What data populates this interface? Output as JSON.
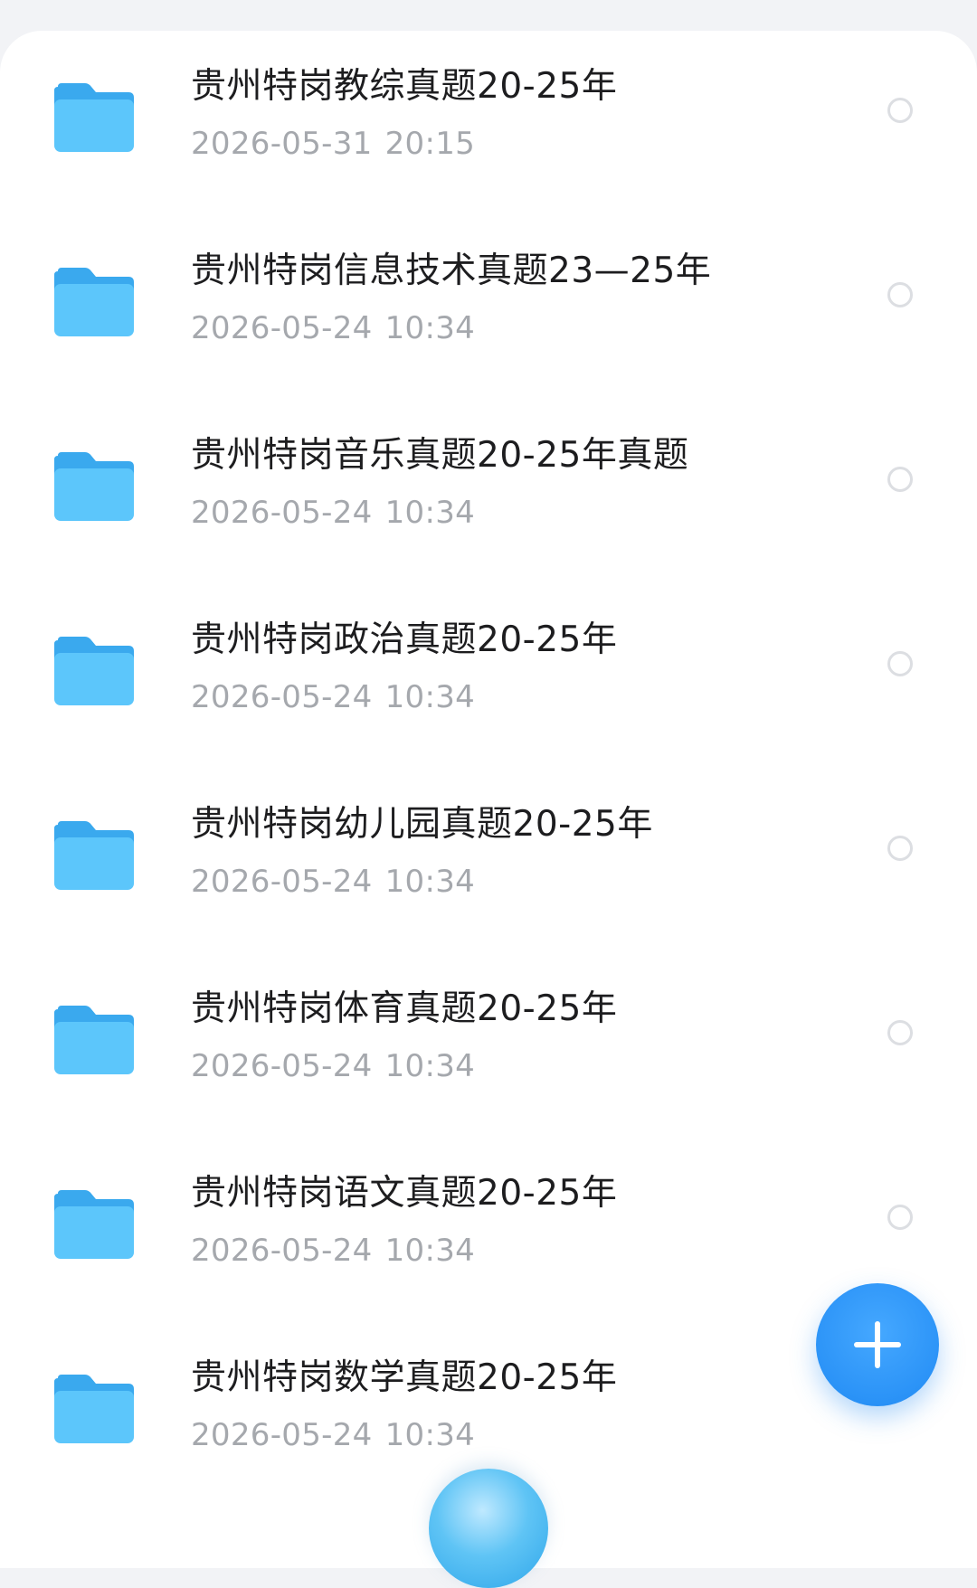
{
  "folders": [
    {
      "name": "贵州特岗教综真题20-25年",
      "date": "2026-05-31",
      "time": "20:15"
    },
    {
      "name": "贵州特岗信息技术真题23—25年",
      "date": "2026-05-24",
      "time": "10:34"
    },
    {
      "name": "贵州特岗音乐真题20-25年真题",
      "date": "2026-05-24",
      "time": "10:34"
    },
    {
      "name": "贵州特岗政治真题20-25年",
      "date": "2026-05-24",
      "time": "10:34"
    },
    {
      "name": "贵州特岗幼儿园真题20-25年",
      "date": "2026-05-24",
      "time": "10:34"
    },
    {
      "name": "贵州特岗体育真题20-25年",
      "date": "2026-05-24",
      "time": "10:34"
    },
    {
      "name": "贵州特岗语文真题20-25年",
      "date": "2026-05-24",
      "time": "10:34"
    },
    {
      "name": "贵州特岗数学真题20-25年",
      "date": "2026-05-24",
      "time": "10:34"
    }
  ],
  "icons": {
    "folder": "folder-icon",
    "select": "radio-circle-icon",
    "fab": "plus-icon"
  },
  "colors": {
    "folder_front": "#5cc6fb",
    "folder_back": "#3aa9ee",
    "fab": "#2b93f7",
    "title": "#1d1d1f",
    "date": "#a5a8ad"
  }
}
